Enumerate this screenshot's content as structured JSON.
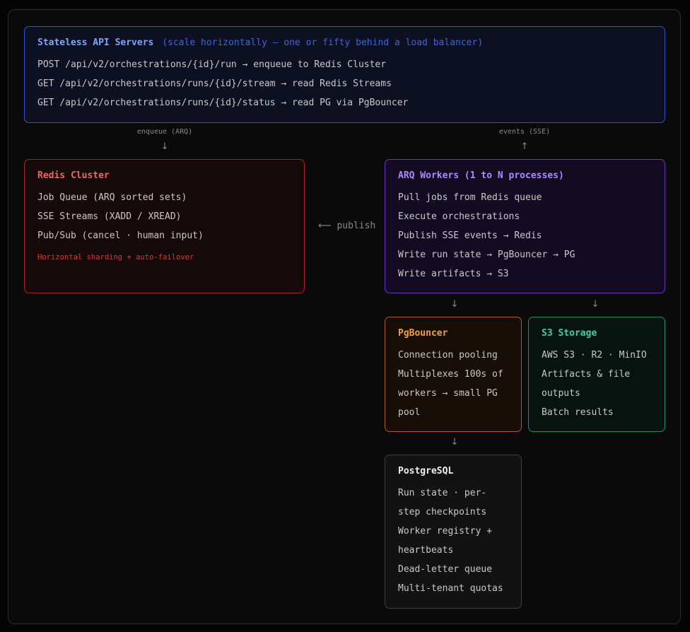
{
  "api": {
    "title": "Stateless API Servers",
    "subtitle": "(scale horizontally — one or fifty behind a load balancer)",
    "lines": [
      "POST /api/v2/orchestrations/{id}/run → enqueue to Redis Cluster",
      "GET /api/v2/orchestrations/runs/{id}/stream → read Redis Streams",
      "GET /api/v2/orchestrations/runs/{id}/status → read PG via PgBouncer"
    ]
  },
  "edges": {
    "enqueue_label": "enqueue (ARQ)",
    "events_label": "events (SSE)",
    "publish_label": "publish",
    "down_arrow": "↓",
    "up_arrow": "↑",
    "left_arrow": "⟵"
  },
  "redis": {
    "title": "Redis Cluster",
    "lines": [
      "Job Queue (ARQ sorted sets)",
      "SSE Streams (XADD / XREAD)",
      "Pub/Sub (cancel · human input)"
    ],
    "note": "Horizontal sharding + auto-failover"
  },
  "workers": {
    "title": "ARQ Workers (1 to N processes)",
    "lines": [
      "Pull jobs from Redis queue",
      "Execute orchestrations",
      "Publish SSE events → Redis",
      "Write run state → PgBouncer → PG",
      "Write artifacts → S3"
    ]
  },
  "pgbouncer": {
    "title": "PgBouncer",
    "lines": [
      "Connection pooling",
      "Multiplexes 100s of workers → small PG pool"
    ]
  },
  "s3": {
    "title": "S3 Storage",
    "lines": [
      "AWS S3 · R2 · MinIO",
      "Artifacts & file outputs",
      "Batch results"
    ]
  },
  "postgres": {
    "title": "PostgreSQL",
    "lines": [
      "Run state · per-step checkpoints",
      "Worker registry + heartbeats",
      "Dead-letter queue",
      "Multi-tenant quotas"
    ]
  },
  "colors": {
    "api_border": "#2f4fd8",
    "redis_border": "#a81d1d",
    "workers_border": "#6a34c8",
    "pgbouncer_border": "#b35a1c",
    "s3_border": "#1e8a6e",
    "postgres_border": "#3d3d3d"
  }
}
